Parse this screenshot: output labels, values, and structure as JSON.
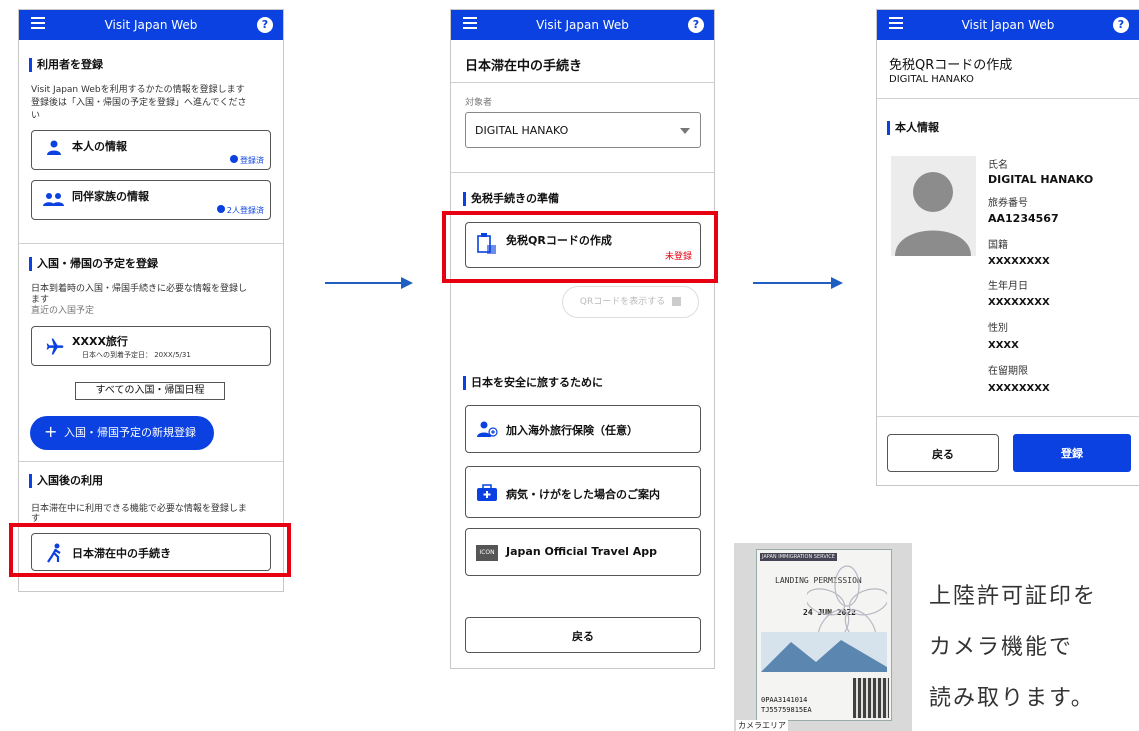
{
  "app_title": "Visit Japan Web",
  "help_icon": "?",
  "screen1": {
    "user_reg_title": "利用者を登録",
    "user_reg_desc1": "Visit Japan Webを利用するかたの情報を登録します",
    "user_reg_desc2": "登録後は「入国・帰国の予定を登録」へ進んでくださ",
    "user_reg_desc3": "い",
    "self_info_label": "本人の情報",
    "self_info_status": "登録済",
    "family_info_label": "同伴家族の情報",
    "family_info_status": "2人登録済",
    "entry_title": "入国・帰国の予定を登録",
    "entry_desc1": "日本到着時の入国・帰国手続きに必要な情報を登録し",
    "entry_desc2": "ます",
    "entry_recent": "直近の入国予定",
    "trip_name": "XXXX旅行",
    "trip_date": "日本への到着予定日： 20XX/5/31",
    "all_schedules_button": "すべての入国・帰国日程",
    "new_register_button": "入国・帰国予定の新規登録",
    "after_entry_title": "入国後の利用",
    "after_entry_desc1": "日本滞在中に利用できる機能で必要な情報を登録しま",
    "after_entry_desc2": "す",
    "stay_procedure_label": "日本滞在中の手続き"
  },
  "screen2": {
    "page_title": "日本滞在中の手続き",
    "target_label": "対象者",
    "target_value": "DIGITAL HANAKO",
    "taxfree_title": "免税手続きの準備",
    "qr_create_label": "免税QRコードの作成",
    "qr_create_status": "未登録",
    "qr_show_button": "QRコードを表示する",
    "safe_travel_title": "日本を安全に旅するために",
    "insurance_label": "加入海外旅行保険（任意）",
    "sick_label": "病気・けがをした場合のご案内",
    "app_label": "Japan Official Travel App",
    "app_icon_text": "ICON",
    "back_button": "戻る"
  },
  "screen3": {
    "page_title": "免税QRコードの作成",
    "page_subtitle": "DIGITAL HANAKO",
    "self_info_title": "本人情報",
    "name_label": "氏名",
    "name_value": "DIGITAL HANAKO",
    "passport_label": "旅券番号",
    "passport_value": "AA1234567",
    "nationality_label": "国籍",
    "nationality_value": "XXXXXXXX",
    "birth_label": "生年月日",
    "birth_value": "XXXXXXXX",
    "gender_label": "性別",
    "gender_value": "XXXX",
    "period_label": "在留期限",
    "period_value": "XXXXXXXX",
    "back_button": "戻る",
    "register_button": "登録"
  },
  "camera": {
    "stamp_title": "LANDING PERMISSION",
    "stamp_header": "JAPAN IMMIGRATION SERVICE",
    "stamp_date": "24 JUN 2022",
    "stamp_code1": "0PAA3141014",
    "stamp_code2": "TJ55759815EA",
    "camera_area_label": "カメラエリア",
    "caption1": "上陸許可証印を",
    "caption2": "カメラ機能で",
    "caption3": "読み取ります。"
  },
  "colors": {
    "accent": "#0a41e0",
    "highlight": "#e60012",
    "arrow": "#1f5fbf"
  }
}
